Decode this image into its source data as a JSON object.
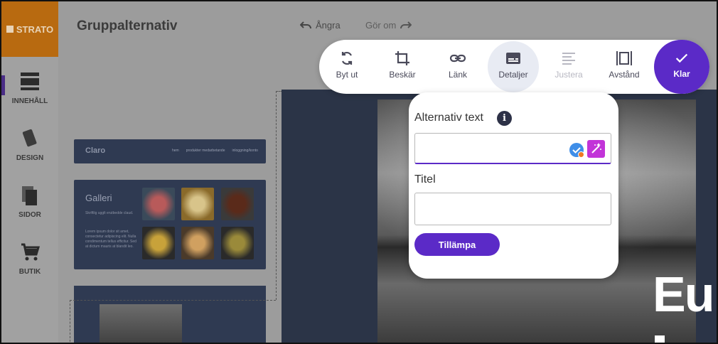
{
  "brand": {
    "logo_text": "STRATO"
  },
  "header": {
    "title": "Gruppalternativ",
    "undo_label": "Ångra",
    "redo_label": "Gör om"
  },
  "rail": {
    "items": [
      {
        "label": "INNEHÅLL",
        "icon": "content-icon"
      },
      {
        "label": "DESIGN",
        "icon": "design-icon"
      },
      {
        "label": "SIDOR",
        "icon": "pages-icon"
      },
      {
        "label": "BUTIK",
        "icon": "cart-icon"
      }
    ]
  },
  "thumbnails": {
    "nav_brand": "Claro",
    "nav_links": [
      "hem",
      "produkter medarbetande",
      "inloggning/konto"
    ],
    "gallery_title": "Galleri",
    "gallery_text_1": "Skriftlig ugglt erutbedde claud.",
    "gallery_text_2": "Lorem ipsum dolor sit amet, consectetur adipiscing elit. Nulla condimentum tellus efficitur. Sed at dictum mauris at blandit leo."
  },
  "toolbar": {
    "items": [
      {
        "label": "Byt ut",
        "icon": "replace-icon"
      },
      {
        "label": "Beskär",
        "icon": "crop-icon"
      },
      {
        "label": "Länk",
        "icon": "link-icon"
      },
      {
        "label": "Detaljer",
        "icon": "details-icon",
        "active": true
      },
      {
        "label": "Justera",
        "icon": "align-icon",
        "disabled": true
      },
      {
        "label": "Avstånd",
        "icon": "spacing-icon"
      }
    ],
    "done_label": "Klar"
  },
  "details_popover": {
    "alt_label": "Alternativ text",
    "alt_value": "",
    "title_label": "Titel",
    "title_value": "",
    "apply_label": "Tillämpa"
  },
  "preview": {
    "heading_fragment": "Eu"
  },
  "colors": {
    "accent": "#5b2ac7",
    "brand": "#b86a10",
    "wand": "#c234d8",
    "check": "#3f8ee8"
  }
}
